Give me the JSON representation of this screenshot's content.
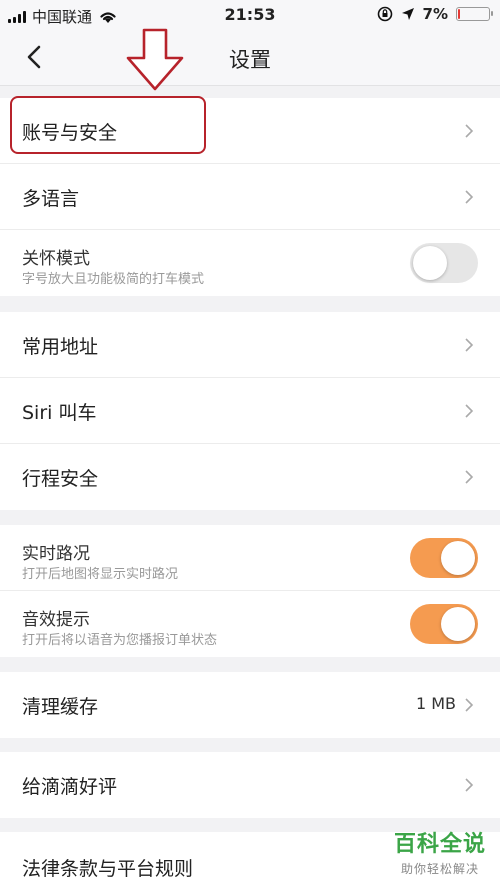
{
  "status_bar": {
    "carrier": "中国联通",
    "time": "21:53",
    "battery_text": "7%",
    "battery_level": 0.07
  },
  "nav": {
    "title": "设置"
  },
  "groups": [
    {
      "rows": [
        {
          "label": "账号与安全"
        },
        {
          "label": "多语言"
        },
        {
          "title": "关怀模式",
          "subtitle": "字号放大且功能极简的打车模式",
          "toggle": "off"
        }
      ]
    },
    {
      "rows": [
        {
          "label": "常用地址"
        },
        {
          "label": "Siri 叫车"
        },
        {
          "label": "行程安全"
        }
      ]
    },
    {
      "rows": [
        {
          "title": "实时路况",
          "subtitle": "打开后地图将显示实时路况",
          "toggle": "on"
        },
        {
          "title": "音效提示",
          "subtitle": "打开后将以语音为您播报订单状态",
          "toggle": "on"
        }
      ]
    },
    {
      "rows": [
        {
          "label": "清理缓存",
          "value": "1 MB"
        }
      ]
    },
    {
      "rows": [
        {
          "label": "给滴滴好评"
        }
      ]
    },
    {
      "rows": [
        {
          "label": "法律条款与平台规则"
        }
      ]
    }
  ],
  "colors": {
    "toggle_on": "#f59b50",
    "annotation": "#b7232b",
    "watermark": "#3ba547"
  },
  "watermark": {
    "main": "百科全说",
    "sub": "助你轻松解决"
  }
}
